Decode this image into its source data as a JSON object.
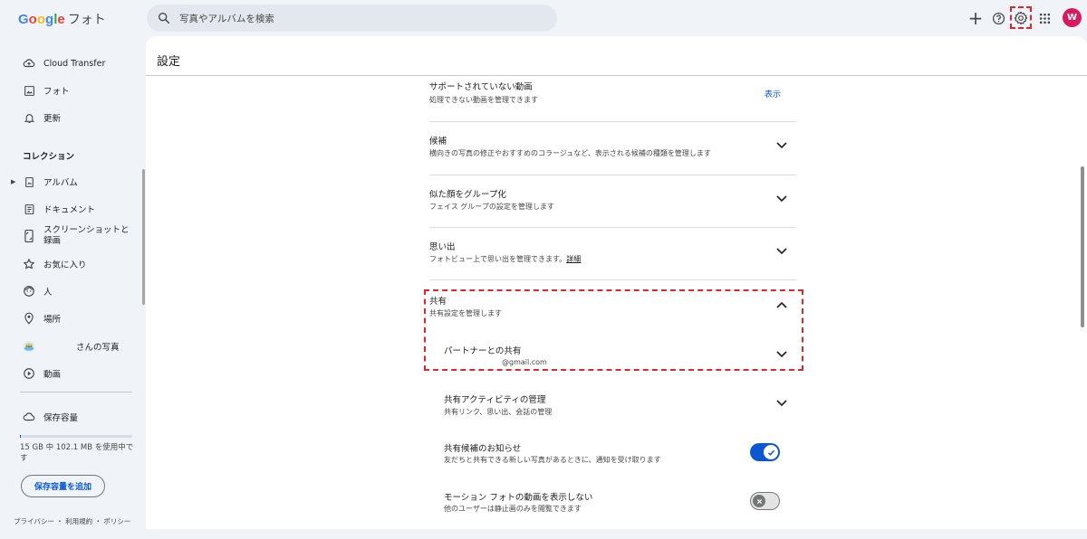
{
  "header": {
    "logo_google": "Google",
    "logo_app": "フォト",
    "search_placeholder": "写真やアルバムを検索",
    "avatar_initial": "W"
  },
  "sidebar": {
    "items_top": [
      {
        "label": "Cloud Transfer",
        "icon": "cloud-transfer-icon"
      },
      {
        "label": "フォト",
        "icon": "photo-icon"
      },
      {
        "label": "更新",
        "icon": "bell-icon"
      }
    ],
    "collections_title": "コレクション",
    "collections": [
      {
        "label": "アルバム",
        "icon": "album-icon"
      },
      {
        "label": "ドキュメント",
        "icon": "document-icon"
      },
      {
        "label": "スクリーンショットと録画",
        "icon": "screenshot-icon"
      },
      {
        "label": "お気に入り",
        "icon": "star-icon"
      },
      {
        "label": "人",
        "icon": "face-icon"
      },
      {
        "label": "場所",
        "icon": "location-icon"
      },
      {
        "label": "さんの写真",
        "icon": "partner-avatar"
      },
      {
        "label": "動画",
        "icon": "video-icon"
      }
    ],
    "storage_label": "保存容量",
    "storage_text": "15 GB 中 102.1 MB を使用中です",
    "storage_used_fraction": 0.0066,
    "add_storage_label": "保存容量を追加",
    "footer": "プライバシー ・ 利用規約 ・ ポリシー"
  },
  "settings": {
    "title": "設定",
    "unsupported": {
      "title": "サポートされていない動画",
      "subtitle": "処理できない動画を管理できます",
      "action": "表示"
    },
    "suggestions": {
      "title": "候補",
      "subtitle": "横向きの写真の修正やおすすめのコラージュなど、表示される候補の種類を管理します"
    },
    "face_group": {
      "title": "似た顔をグループ化",
      "subtitle": "フェイス グループの設定を管理します"
    },
    "memories": {
      "title": "思い出",
      "subtitle": "フォトビュー上で思い出を管理できます。",
      "link": "詳細"
    },
    "sharing": {
      "title": "共有",
      "subtitle": "共有設定を管理します"
    },
    "partner": {
      "title": "パートナーとの共有",
      "email": "@gmail.com"
    },
    "activity": {
      "title": "共有アクティビティの管理",
      "subtitle": "共有リンク、思い出、会話の管理"
    },
    "suggest_notify": {
      "title": "共有候補のお知らせ",
      "subtitle": "友だちと共有できる新しい写真があるときに、通知を受け取ります",
      "enabled": true
    },
    "motion": {
      "title": "モーション フォトの動画を表示しない",
      "subtitle": "他のユーザーは静止画のみを閲覧できます",
      "enabled": false
    }
  }
}
